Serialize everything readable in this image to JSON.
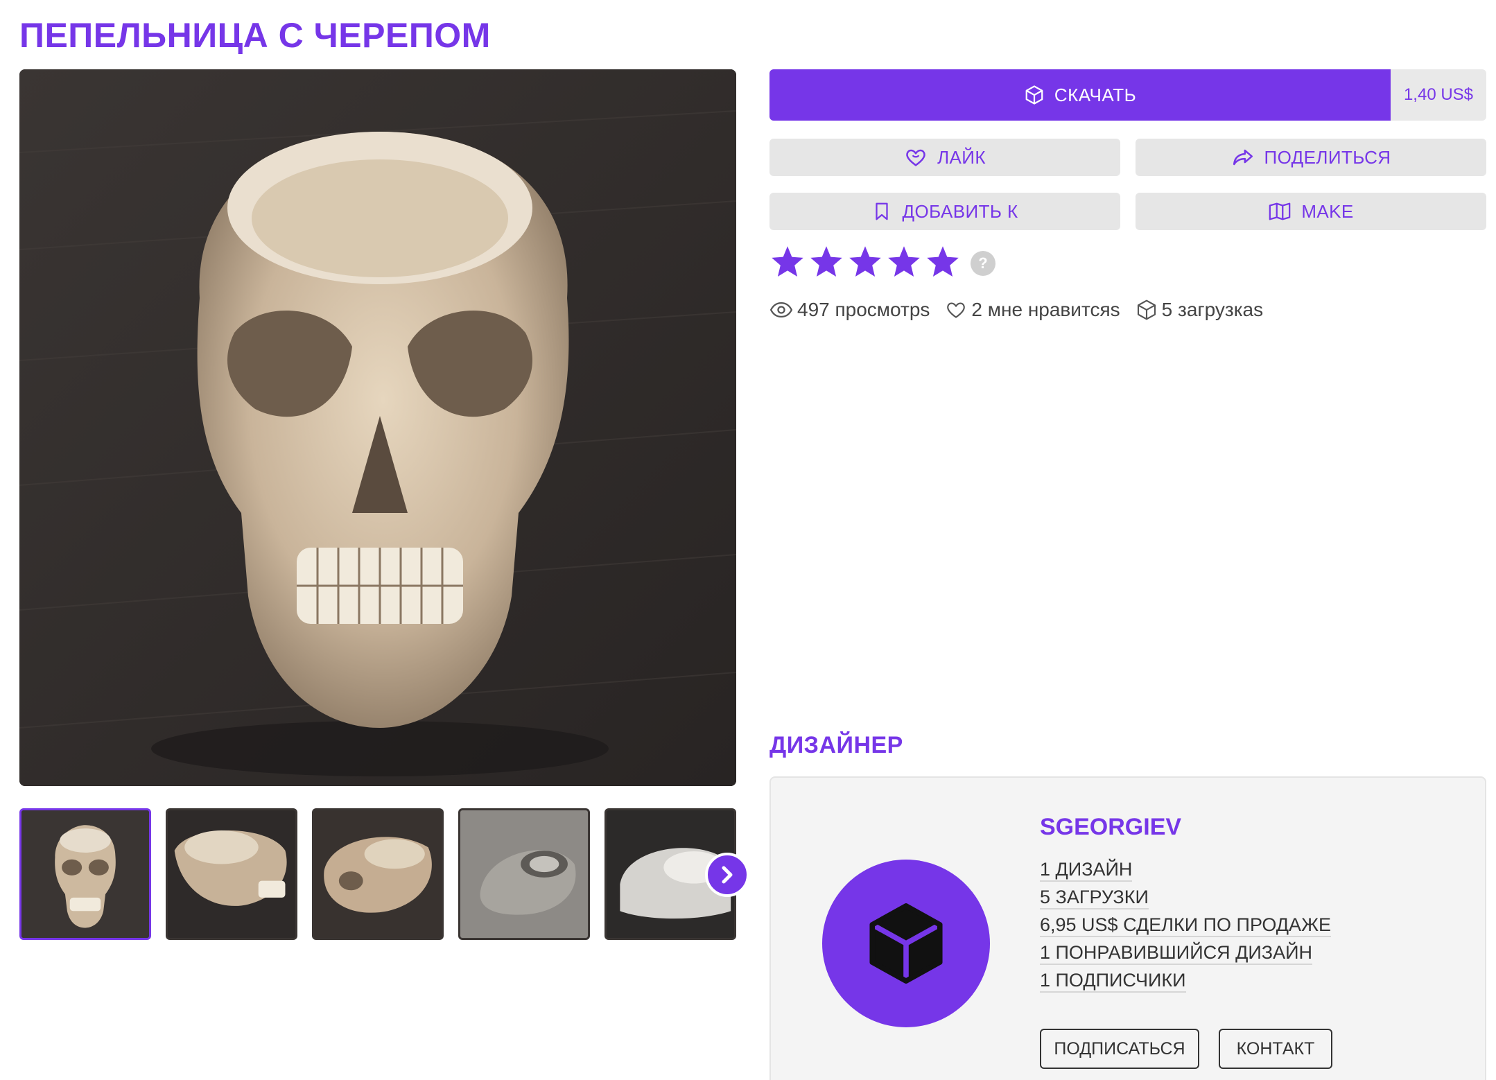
{
  "page": {
    "title": "ПЕПЕЛЬНИЦА С ЧЕРЕПОМ"
  },
  "actions": {
    "download_label": "СКАЧАТЬ",
    "price": "1,40 US$",
    "like_label": "ЛАЙК",
    "share_label": "ПОДЕЛИТЬСЯ",
    "add_to_label": "ДОБАВИТЬ К",
    "make_label": "MAKE"
  },
  "rating": {
    "stars": 5,
    "max": 5,
    "help_glyph": "?"
  },
  "stats": {
    "views": "497 просмотрs",
    "likes": "2 мне нравитсяs",
    "downloads": "5 загрузкаs"
  },
  "designer": {
    "heading": "ДИЗАЙНЕР",
    "name": "SGEORGIEV",
    "stats": [
      "1 ДИЗАЙН",
      "5 ЗАГРУЗКИ",
      "6,95 US$ СДЕЛКИ ПО ПРОДАЖЕ",
      "1 ПОНРАВИВШИЙСЯ ДИЗАЙН",
      "1 ПОДПИСЧИКИ"
    ],
    "follow_label": "ПОДПИСАТЬСЯ",
    "contact_label": "КОНТАКТ"
  },
  "gallery": {
    "thumbnail_count": 5,
    "active_index": 0
  },
  "colors": {
    "accent": "#7636e8",
    "button_grey": "#e6e6e6",
    "card_bg": "#f4f4f4"
  },
  "icons": [
    "cube-icon",
    "heart-icon",
    "share-arrow-icon",
    "bookmark-icon",
    "open-book-icon",
    "star-icon",
    "help-icon",
    "eye-icon",
    "chevron-right-icon"
  ]
}
